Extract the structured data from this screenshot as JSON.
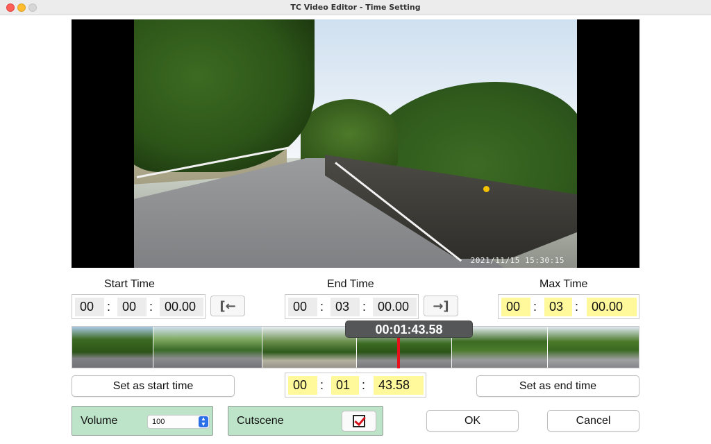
{
  "window": {
    "title": "TC Video Editor - Time Setting"
  },
  "video": {
    "timestamp": "2021/11/15 15:30:15"
  },
  "start": {
    "label": "Start Time",
    "hh": "00",
    "mm": "00",
    "ss": "00.00",
    "set_icon": "arrow-to-left-bar"
  },
  "end": {
    "label": "End Time",
    "hh": "00",
    "mm": "03",
    "ss": "00.00",
    "set_icon": "arrow-to-right-bar"
  },
  "max": {
    "label": "Max Time",
    "hh": "00",
    "mm": "03",
    "ss": "00.00",
    "highlight": "#fff99c"
  },
  "timeline": {
    "playhead_time": "00:01:43.58",
    "playhead_color": "#e8101b",
    "playhead_fraction": 0.575
  },
  "current": {
    "hh": "00",
    "mm": "01",
    "ss": "43.58"
  },
  "buttons": {
    "set_start": "Set as start time",
    "set_end": "Set as end time",
    "ok": "OK",
    "cancel": "Cancel"
  },
  "volume": {
    "label": "Volume",
    "value": "100"
  },
  "cutscene": {
    "label": "Cutscene",
    "checked": true
  },
  "colors": {
    "panel_green": "#bde3c8",
    "field_yellow": "#fff99c"
  }
}
